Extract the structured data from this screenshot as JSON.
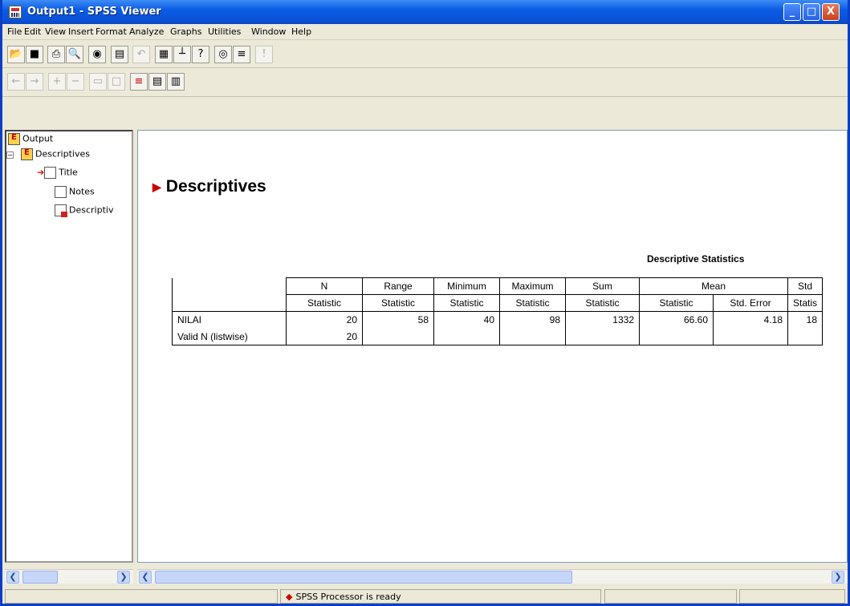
{
  "window": {
    "title": "Output1 - SPSS Viewer",
    "minimize": "_",
    "maximize": "□",
    "close": "X"
  },
  "menu": [
    "File",
    "Edit",
    "View",
    "Insert",
    "Format",
    "Analyze",
    "Graphs",
    "Utilities",
    "Window",
    "Help"
  ],
  "toolbar1_icons": [
    "open-icon",
    "save-icon",
    "print-icon",
    "print-preview-icon",
    "export-icon",
    "dialog-recall-icon",
    "undo-icon",
    "goto-data-icon",
    "goto-case-icon",
    "variables-icon",
    "use-sets-icon",
    "insert-cases-icon",
    "run-icon"
  ],
  "toolbar2_icons": [
    "promote-icon",
    "demote-icon",
    "expand-icon",
    "collapse-icon",
    "show-icon",
    "hide-icon",
    "insert-heading-icon",
    "insert-title-icon",
    "insert-text-icon"
  ],
  "tree": {
    "root": "Output",
    "node": "Descriptives",
    "children": [
      "Title",
      "Notes",
      "Descriptiv"
    ]
  },
  "content": {
    "heading": "Descriptives",
    "table_title": "Descriptive Statistics",
    "header_row1": [
      "",
      "N",
      "Range",
      "Minimum",
      "Maximum",
      "Sum",
      "Mean",
      "Std"
    ],
    "header_row2": [
      "",
      "Statistic",
      "Statistic",
      "Statistic",
      "Statistic",
      "Statistic",
      "Statistic",
      "Std. Error",
      "Statis"
    ],
    "rows": [
      [
        "NILAI",
        "20",
        "58",
        "40",
        "98",
        "1332",
        "66.60",
        "4.18",
        "18"
      ],
      [
        "Valid N (listwise)",
        "20",
        "",
        "",
        "",
        "",
        "",
        "",
        ""
      ]
    ]
  },
  "status": {
    "text": "SPSS Processor  is ready"
  }
}
